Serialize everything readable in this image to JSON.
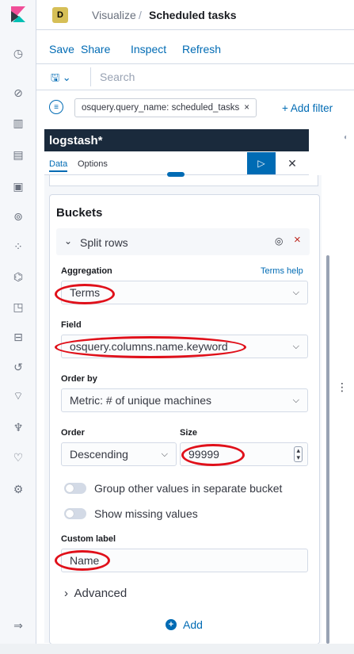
{
  "header": {
    "space_badge": "D",
    "breadcrumb_parent": "Visualize",
    "breadcrumb_sep": "/",
    "breadcrumb_current": "Scheduled tasks"
  },
  "menu": {
    "save": "Save",
    "share": "Share",
    "inspect": "Inspect",
    "refresh": "Refresh"
  },
  "search": {
    "placeholder": "Search"
  },
  "filter": {
    "pill_text": "osquery.query_name: scheduled_tasks",
    "add_filter": "+ Add filter"
  },
  "editor": {
    "index_title": "logstash*",
    "tabs": [
      "Data",
      "Options"
    ],
    "buckets_title": "Buckets",
    "split_label": "Split rows",
    "aggregation_label": "Aggregation",
    "terms_help": "Terms help",
    "aggregation_value": "Terms",
    "field_label": "Field",
    "field_value": "osquery.columns.name.keyword",
    "order_by_label": "Order by",
    "order_by_value": "Metric: # of unique machines",
    "order_label": "Order",
    "order_value": "Descending",
    "size_label": "Size",
    "size_value": "99999",
    "group_other": "Group other values in separate bucket",
    "show_missing": "Show missing values",
    "custom_label": "Custom label",
    "custom_value": "Name",
    "advanced": "Advanced",
    "add": "Add"
  },
  "icons": {
    "logo": "kibana-logo",
    "nav": [
      "clock-icon",
      "compass-icon",
      "visualize-icon",
      "dashboard-icon",
      "canvas-icon",
      "maps-icon",
      "ml-icon",
      "infra-icon",
      "logs-icon",
      "apm-icon",
      "uptime-icon",
      "siem-icon",
      "dev-tools-icon",
      "monitoring-icon",
      "management-icon",
      "collapse-icon"
    ]
  },
  "colors": {
    "accent": "#006bb4",
    "panel_header": "#1a2a3c",
    "annotation": "#e0101a"
  }
}
